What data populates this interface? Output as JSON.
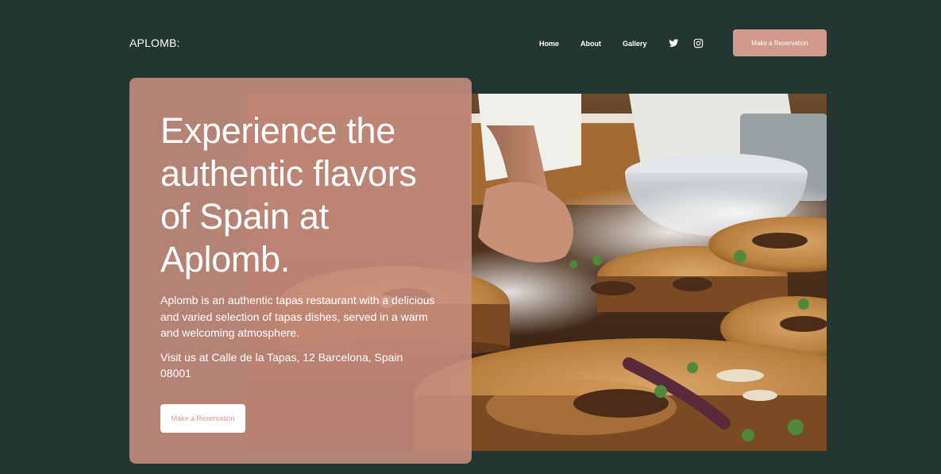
{
  "brand": {
    "logo": "APLOMB:"
  },
  "nav": {
    "items": [
      {
        "label": "Home"
      },
      {
        "label": "About"
      },
      {
        "label": "Gallery"
      }
    ],
    "social": [
      {
        "icon": "twitter-icon"
      },
      {
        "icon": "instagram-icon"
      }
    ],
    "cta_label": "Make a Reservation"
  },
  "hero": {
    "headline": "Experience the authentic flavors of Spain at Aplomb.",
    "description": "Aplomb is an authentic tapas restaurant with a delicious and varied selection of tapas dishes, served in a warm and welcoming atmosphere.",
    "address": "Visit us at Calle de la Tapas, 12 Barcelona, Spain 08001",
    "cta_label": "Make a Reservation"
  },
  "colors": {
    "background": "#243632",
    "accent": "#d19a8d",
    "card": "#c98e80",
    "text": "#ffffff"
  }
}
